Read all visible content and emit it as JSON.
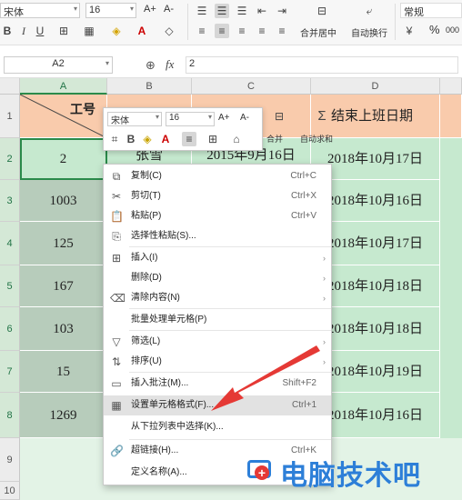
{
  "ribbon": {
    "font_name": "宋体",
    "font_size": "16",
    "font_grow_label": "A+",
    "font_shrink_label": "A-",
    "merge_label": "合并居中",
    "wrap_label": "自动换行",
    "number_format": "常规",
    "percent_label": "%",
    "comma_label": "000"
  },
  "formula_bar": {
    "name_box": "A2",
    "fx_label": "fx",
    "value": "2"
  },
  "columns": [
    "A",
    "B",
    "C",
    "D"
  ],
  "rows": [
    "1",
    "2",
    "3",
    "4",
    "5",
    "6",
    "7",
    "8",
    "9",
    "10"
  ],
  "header_row": {
    "a": "工号",
    "b": "张雪",
    "c": "",
    "d": "结束上班日期"
  },
  "data_rows": [
    {
      "id": "2",
      "name": "张雪",
      "start": "2015年9月16日",
      "end": "2018年10月17日"
    },
    {
      "id": "1003",
      "name": "",
      "start": "",
      "end": "2018年10月16日"
    },
    {
      "id": "125",
      "name": "",
      "start": "",
      "end": "2018年10月17日"
    },
    {
      "id": "167",
      "name": "",
      "start": "",
      "end": "2018年10月18日"
    },
    {
      "id": "103",
      "name": "",
      "start": "",
      "end": "2018年10月18日"
    },
    {
      "id": "15",
      "name": "",
      "start": "",
      "end": "2018年10月19日"
    },
    {
      "id": "1269",
      "name": "",
      "start": "",
      "end": "2018年10月16日"
    }
  ],
  "mini_toolbar": {
    "font": "宋体",
    "size": "16",
    "grow": "A+",
    "shrink": "A-",
    "merge": "合并",
    "autosum": "自动求和"
  },
  "context_menu": [
    {
      "icon": "copy-icon",
      "glyph": "⧉",
      "label": "复制(C)",
      "shortcut": "Ctrl+C",
      "arrow": ""
    },
    {
      "icon": "cut-icon",
      "glyph": "✂",
      "label": "剪切(T)",
      "shortcut": "Ctrl+X",
      "arrow": ""
    },
    {
      "icon": "paste-icon",
      "glyph": "📋",
      "label": "粘贴(P)",
      "shortcut": "Ctrl+V",
      "arrow": ""
    },
    {
      "icon": "paste-special-icon",
      "glyph": "⎘",
      "label": "选择性粘贴(S)...",
      "shortcut": "",
      "arrow": ""
    },
    {
      "icon": "insert-icon",
      "glyph": "⊞",
      "label": "插入(I)",
      "shortcut": "",
      "arrow": "›"
    },
    {
      "icon": "",
      "glyph": "",
      "label": "删除(D)",
      "shortcut": "",
      "arrow": "›"
    },
    {
      "icon": "clear-icon",
      "glyph": "⌫",
      "label": "清除内容(N)",
      "shortcut": "",
      "arrow": "›"
    },
    {
      "icon": "",
      "glyph": "",
      "label": "批量处理单元格(P)",
      "shortcut": "",
      "arrow": ""
    },
    {
      "icon": "filter-icon",
      "glyph": "▽",
      "label": "筛选(L)",
      "shortcut": "",
      "arrow": "›"
    },
    {
      "icon": "sort-icon",
      "glyph": "⇅",
      "label": "排序(U)",
      "shortcut": "",
      "arrow": "›"
    },
    {
      "icon": "comment-icon",
      "glyph": "▭",
      "label": "插入批注(M)...",
      "shortcut": "Shift+F2",
      "arrow": ""
    },
    {
      "icon": "format-cells-icon",
      "glyph": "▦",
      "label": "设置单元格格式(F)...",
      "shortcut": "Ctrl+1",
      "arrow": ""
    },
    {
      "icon": "",
      "glyph": "",
      "label": "从下拉列表中选择(K)...",
      "shortcut": "",
      "arrow": ""
    },
    {
      "icon": "hyperlink-icon",
      "glyph": "🔗",
      "label": "超链接(H)...",
      "shortcut": "Ctrl+K",
      "arrow": ""
    },
    {
      "icon": "",
      "glyph": "",
      "label": "定义名称(A)...",
      "shortcut": "",
      "arrow": ""
    }
  ],
  "watermark": {
    "text": "电脑技术吧"
  },
  "colors": {
    "header_fill": "#f9cbac",
    "data_fill": "#c6e9cf",
    "selected_fill": "#b7ccbb",
    "arrow": "#e53935",
    "accent": "#217346"
  }
}
